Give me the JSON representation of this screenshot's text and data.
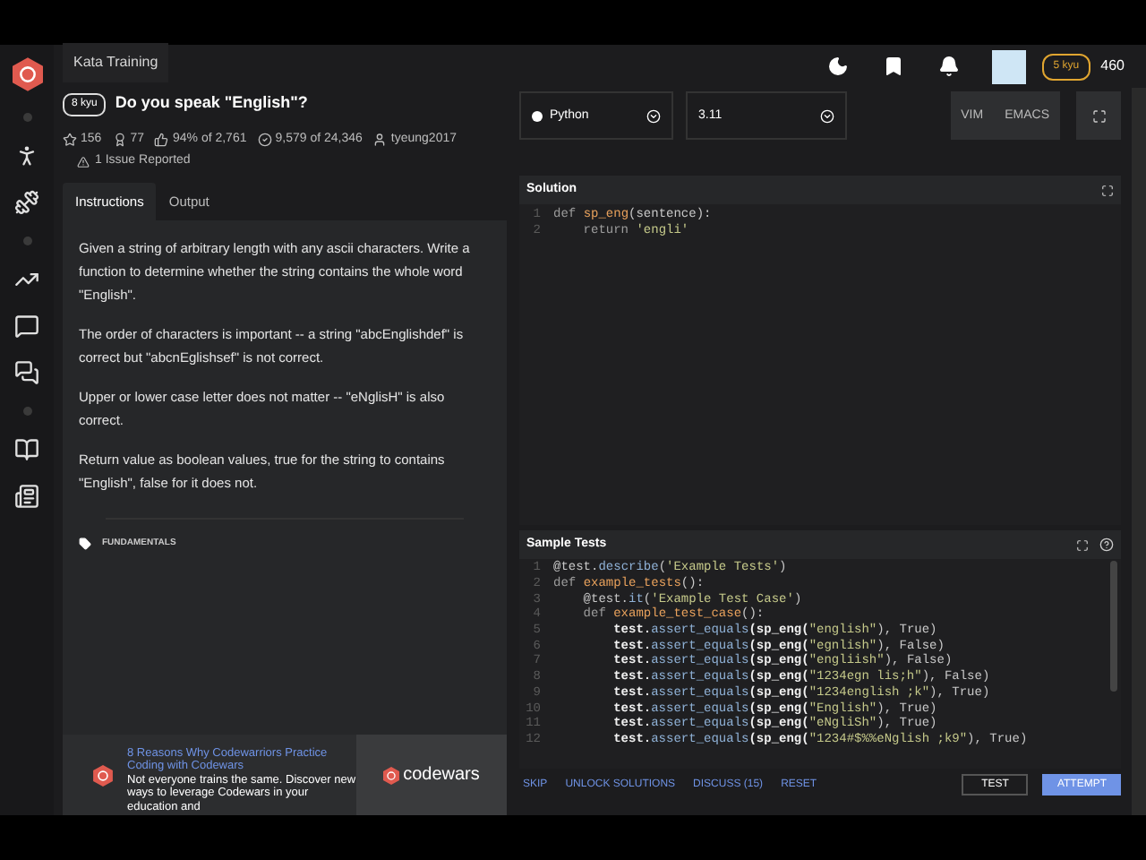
{
  "top_tab": "Kata Training",
  "user": {
    "rank": "5 kyu",
    "honor": "460"
  },
  "kata": {
    "rank": "8 kyu",
    "title": "Do you speak \"English\"?",
    "stats": [
      {
        "kind": "stars",
        "text": "156"
      },
      {
        "kind": "collections",
        "text": "77"
      },
      {
        "kind": "satisfaction",
        "text": "94% of 2,761"
      },
      {
        "kind": "completed",
        "text": "9,579 of 24,346"
      },
      {
        "kind": "author",
        "text": "tyeung2017"
      }
    ],
    "issues": "1 Issue Reported"
  },
  "tabs": [
    {
      "label": "Instructions",
      "selected": true
    },
    {
      "label": "Output",
      "selected": false
    }
  ],
  "instructions": [
    "Given a string of arbitrary length with any ascii characters. Write a function to determine whether the string contains the whole word \"English\".",
    "The order of characters is important -- a string \"abcEnglishdef\" is correct but \"abcnEglishsef\" is not correct.",
    "Upper or lower case letter does not matter -- \"eNglisH\" is also correct.",
    "Return value as boolean values, true for the string to contains \"English\", false for it does not."
  ],
  "tags": [
    "FUNDAMENTALS"
  ],
  "ad": {
    "title": "8 Reasons Why Codewarriors Practice Coding with Codewars",
    "body": "Not everyone trains the same. Discover new ways to leverage Codewars in your education and",
    "brand": "codewars"
  },
  "language": "Python",
  "version": "3.11",
  "editor_modes": [
    {
      "label": "VIM",
      "selected": false
    },
    {
      "label": "EMACS",
      "selected": false
    }
  ],
  "solution": {
    "title": "Solution",
    "lines": [
      {
        "n": "1",
        "tokens": [
          {
            "text": "def ",
            "kind": "kw"
          },
          {
            "text": "sp_eng",
            "kind": "fn"
          },
          {
            "text": "(sentence):",
            "kind": "plain"
          }
        ]
      },
      {
        "n": "2",
        "tokens": [
          {
            "text": "    return ",
            "kind": "kw"
          },
          {
            "text": "'engli'",
            "kind": "str"
          }
        ]
      }
    ]
  },
  "tests": {
    "title": "Sample Tests",
    "lines": [
      {
        "n": "1",
        "tokens": [
          {
            "text": "@test.",
            "kind": "plain"
          },
          {
            "text": "describe",
            "kind": "method"
          },
          {
            "text": "(",
            "kind": "plain"
          },
          {
            "text": "'Example Tests'",
            "kind": "str"
          },
          {
            "text": ")",
            "kind": "plain"
          }
        ]
      },
      {
        "n": "2",
        "tokens": [
          {
            "text": "def ",
            "kind": "kw"
          },
          {
            "text": "example_tests",
            "kind": "fn"
          },
          {
            "text": "():",
            "kind": "plain"
          }
        ]
      },
      {
        "n": "3",
        "tokens": [
          {
            "text": "    @test.",
            "kind": "plain"
          },
          {
            "text": "it",
            "kind": "method"
          },
          {
            "text": "(",
            "kind": "plain"
          },
          {
            "text": "'Example Test Case'",
            "kind": "str"
          },
          {
            "text": ")",
            "kind": "plain"
          }
        ]
      },
      {
        "n": "4",
        "tokens": [
          {
            "text": "    def ",
            "kind": "kw"
          },
          {
            "text": "example_test_case",
            "kind": "fn"
          },
          {
            "text": "():",
            "kind": "plain"
          }
        ]
      },
      {
        "n": "5",
        "tokens": [
          {
            "text": "        test.",
            "kind": "bold"
          },
          {
            "text": "assert_equals",
            "kind": "method"
          },
          {
            "text": "(sp_eng(",
            "kind": "bold"
          },
          {
            "text": "\"english\"",
            "kind": "str"
          },
          {
            "text": "), True)",
            "kind": "plain"
          }
        ]
      },
      {
        "n": "6",
        "tokens": [
          {
            "text": "        test.",
            "kind": "bold"
          },
          {
            "text": "assert_equals",
            "kind": "method"
          },
          {
            "text": "(sp_eng(",
            "kind": "bold"
          },
          {
            "text": "\"egnlish\"",
            "kind": "str"
          },
          {
            "text": "), False)",
            "kind": "plain"
          }
        ]
      },
      {
        "n": "7",
        "tokens": [
          {
            "text": "        test.",
            "kind": "bold"
          },
          {
            "text": "assert_equals",
            "kind": "method"
          },
          {
            "text": "(sp_eng(",
            "kind": "bold"
          },
          {
            "text": "\"engliish\"",
            "kind": "str"
          },
          {
            "text": "), False)",
            "kind": "plain"
          }
        ]
      },
      {
        "n": "8",
        "tokens": [
          {
            "text": "        test.",
            "kind": "bold"
          },
          {
            "text": "assert_equals",
            "kind": "method"
          },
          {
            "text": "(sp_eng(",
            "kind": "bold"
          },
          {
            "text": "\"1234egn lis;h\"",
            "kind": "str"
          },
          {
            "text": "), False)",
            "kind": "plain"
          }
        ]
      },
      {
        "n": "9",
        "tokens": [
          {
            "text": "        test.",
            "kind": "bold"
          },
          {
            "text": "assert_equals",
            "kind": "method"
          },
          {
            "text": "(sp_eng(",
            "kind": "bold"
          },
          {
            "text": "\"1234english ;k\"",
            "kind": "str"
          },
          {
            "text": "), True)",
            "kind": "plain"
          }
        ]
      },
      {
        "n": "10",
        "tokens": [
          {
            "text": "        test.",
            "kind": "bold"
          },
          {
            "text": "assert_equals",
            "kind": "method"
          },
          {
            "text": "(sp_eng(",
            "kind": "bold"
          },
          {
            "text": "\"English\"",
            "kind": "str"
          },
          {
            "text": "), True)",
            "kind": "plain"
          }
        ]
      },
      {
        "n": "11",
        "tokens": [
          {
            "text": "        test.",
            "kind": "bold"
          },
          {
            "text": "assert_equals",
            "kind": "method"
          },
          {
            "text": "(sp_eng(",
            "kind": "bold"
          },
          {
            "text": "\"eNgliSh\"",
            "kind": "str"
          },
          {
            "text": "), True)",
            "kind": "plain"
          }
        ]
      },
      {
        "n": "12",
        "tokens": [
          {
            "text": "        test.",
            "kind": "bold"
          },
          {
            "text": "assert_equals",
            "kind": "method"
          },
          {
            "text": "(sp_eng(",
            "kind": "bold"
          },
          {
            "text": "\"1234#$%%eNglish ;k9\"",
            "kind": "str"
          },
          {
            "text": "), True)",
            "kind": "plain"
          }
        ]
      }
    ]
  },
  "actions": [
    {
      "label": "SKIP",
      "kind": "link"
    },
    {
      "label": "UNLOCK SOLUTIONS",
      "kind": "link"
    },
    {
      "label": "DISCUSS (15)",
      "kind": "link"
    },
    {
      "label": "RESET",
      "kind": "link"
    },
    {
      "label": "TEST",
      "kind": "outline"
    },
    {
      "label": "ATTEMPT",
      "kind": "primary"
    }
  ]
}
